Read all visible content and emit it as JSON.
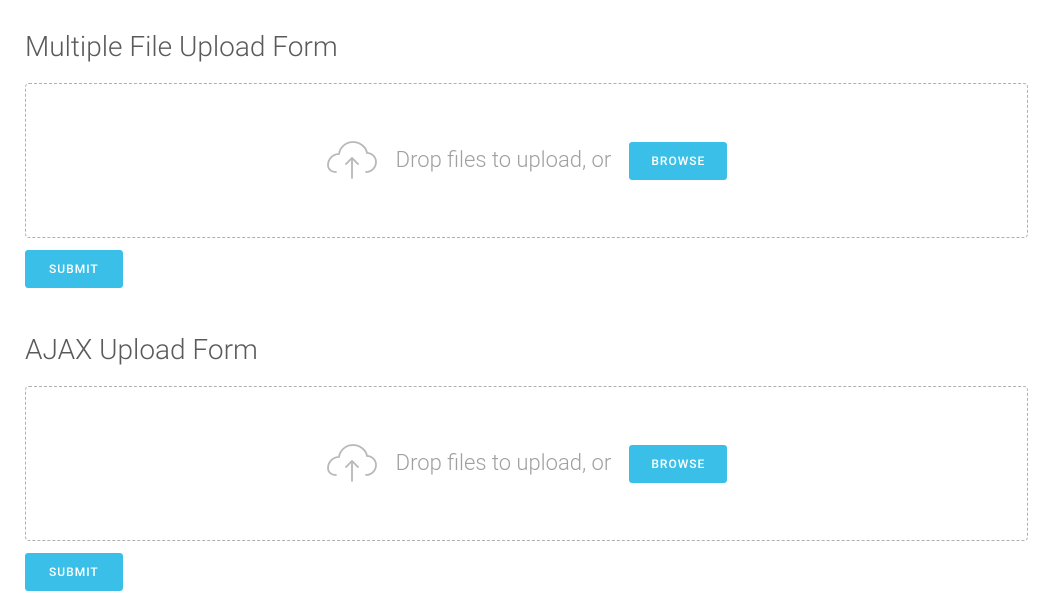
{
  "forms": {
    "multiple": {
      "title": "Multiple File Upload Form",
      "drop_text": "Drop files to upload, or",
      "browse_label": "BROWSE",
      "submit_label": "SUBMIT"
    },
    "ajax": {
      "title": "AJAX Upload Form",
      "drop_text": "Drop files to upload, or",
      "browse_label": "BROWSE",
      "submit_label": "SUBMIT"
    }
  }
}
